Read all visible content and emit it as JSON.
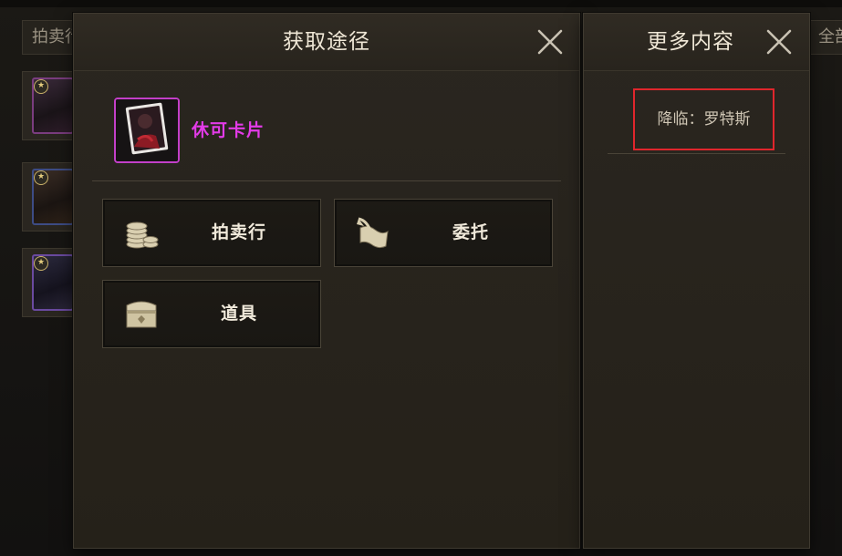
{
  "background": {
    "tab_left": "拍卖行",
    "tab_right": "全部"
  },
  "acquire_panel": {
    "title": "获取途径",
    "item": {
      "name": "休可卡片",
      "name_color": "#e33be8",
      "rarity_border": "#c33fc8"
    },
    "sources": [
      {
        "label": "拍卖行",
        "icon": "coin-stack-icon"
      },
      {
        "label": "委托",
        "icon": "scroll-quill-icon"
      },
      {
        "label": "道具",
        "icon": "treasure-chest-icon"
      }
    ]
  },
  "more_panel": {
    "title": "更多内容",
    "items": [
      {
        "label": "降临：罗特斯",
        "highlight_color": "#e0262c"
      }
    ]
  }
}
